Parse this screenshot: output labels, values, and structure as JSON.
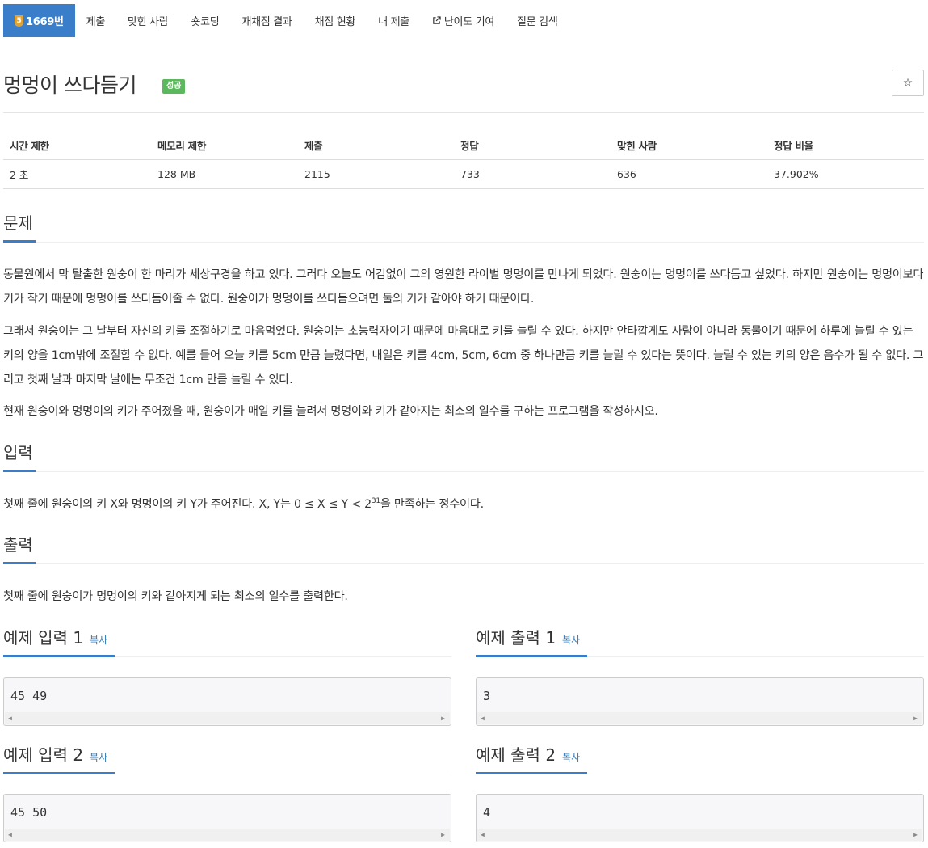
{
  "tabs": {
    "active": {
      "level": "5",
      "label": "1669번"
    },
    "items": [
      "제출",
      "맞힌 사람",
      "숏코딩",
      "재채점 결과",
      "채점 현황",
      "내 제출",
      "난이도 기여",
      "질문 검색"
    ]
  },
  "problem": {
    "title": "멍멍이 쓰다듬기",
    "status": "성공",
    "star": "☆"
  },
  "info": {
    "headers": [
      "시간 제한",
      "메모리 제한",
      "제출",
      "정답",
      "맞힌 사람",
      "정답 비율"
    ],
    "values": [
      "2 초",
      "128 MB",
      "2115",
      "733",
      "636",
      "37.902%"
    ]
  },
  "sections": {
    "problem": "문제",
    "input": "입력",
    "output": "출력"
  },
  "description": [
    "동물원에서 막 탈출한 원숭이 한 마리가 세상구경을 하고 있다. 그러다 오늘도 어김없이 그의 영원한 라이벌 멍멍이를 만나게 되었다. 원숭이는 멍멍이를 쓰다듬고 싶었다. 하지만 원숭이는 멍멍이보다 키가 작기 때문에 멍멍이를 쓰다듬어줄 수 없다. 원숭이가 멍멍이를 쓰다듬으려면 둘의 키가 같아야 하기 때문이다.",
    "그래서 원숭이는 그 날부터 자신의 키를 조절하기로 마음먹었다. 원숭이는 초능력자이기 때문에 마음대로 키를 늘릴 수 있다. 하지만 안타깝게도 사람이 아니라 동물이기 때문에 하루에 늘릴 수 있는 키의 양을 1cm밖에 조절할 수 없다. 예를 들어 오늘 키를 5cm 만큼 늘렸다면, 내일은 키를 4cm, 5cm, 6cm 중 하나만큼 키를 늘릴 수 있다는 뜻이다. 늘릴 수 있는 키의 양은 음수가 될 수 없다. 그리고 첫째 날과 마지막 날에는 무조건 1cm 만큼 늘릴 수 있다.",
    "현재 원숭이와 멍멍이의 키가 주어졌을 때, 원숭이가 매일 키를 늘려서 멍멍이와 키가 같아지는 최소의 일수를 구하는 프로그램을 작성하시오."
  ],
  "input_text": {
    "before": "첫째 줄에 원숭이의 키 X와 멍멍이의 키 Y가 주어진다. X, Y는 0 ≤ X ≤ Y < 2",
    "sup": "31",
    "after": "을 만족하는 정수이다."
  },
  "output_text": "첫째 줄에 원숭이가 멍멍이의 키와 같아지게 되는 최소의 일수를 출력한다.",
  "samples": {
    "copy_label": "복사",
    "in1": {
      "title": "예제 입력 1",
      "code": "45 49"
    },
    "out1": {
      "title": "예제 출력 1",
      "code": "3"
    },
    "in2": {
      "title": "예제 입력 2",
      "code": "45 50"
    },
    "out2": {
      "title": "예제 출력 2",
      "code": "4"
    }
  }
}
